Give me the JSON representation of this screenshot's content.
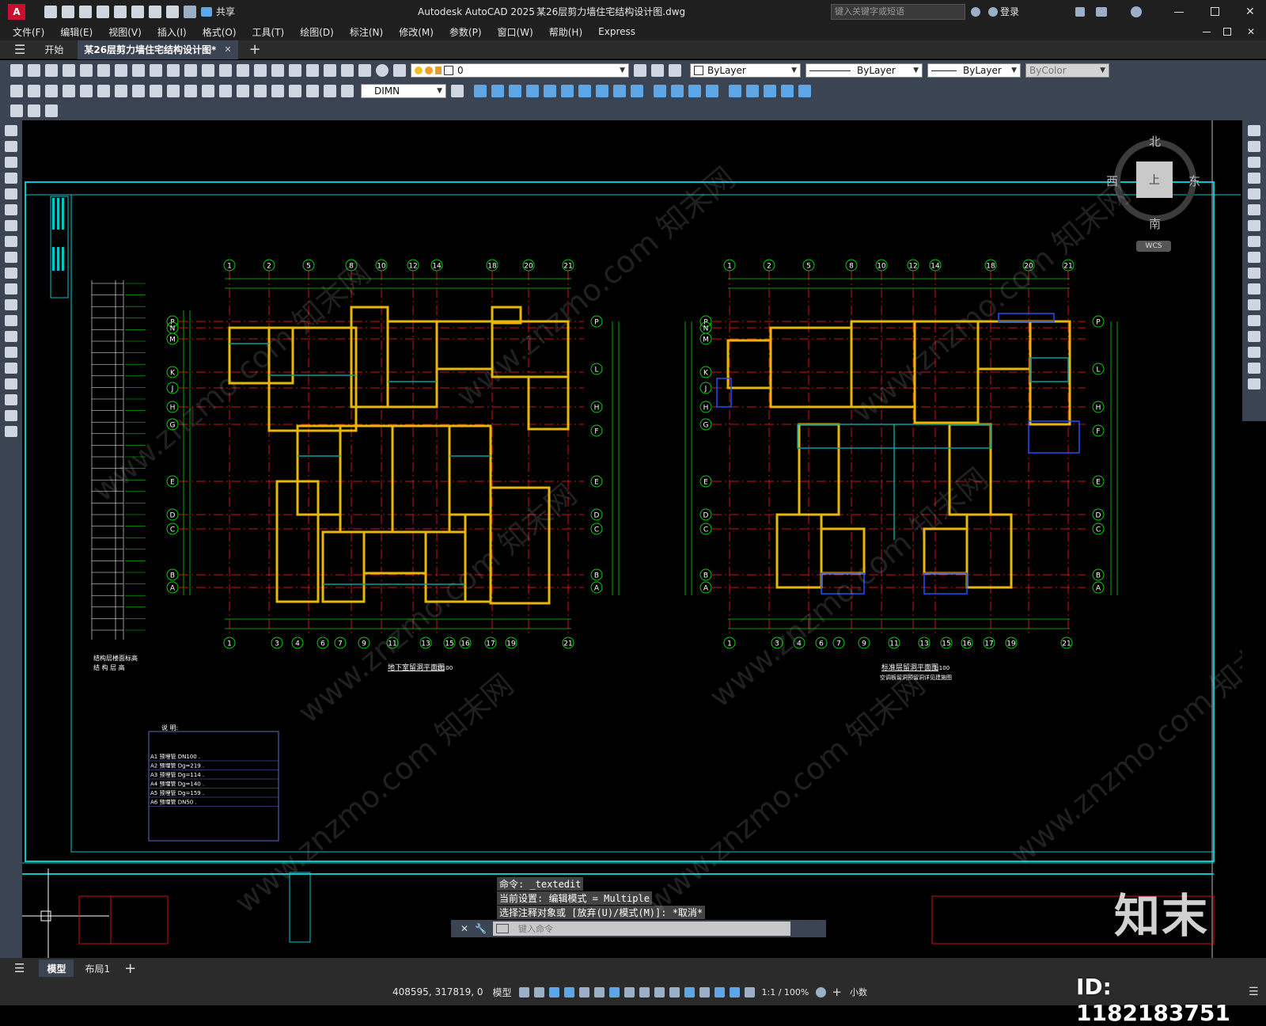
{
  "titlebar": {
    "app_badge": "A",
    "share_label": "共享",
    "app_title": "Autodesk AutoCAD 2025",
    "file_title": "某26层剪力墙住宅结构设计图.dwg",
    "search_placeholder": "键入关键字或短语",
    "login_label": "登录"
  },
  "menu": [
    "文件(F)",
    "编辑(E)",
    "视图(V)",
    "插入(I)",
    "格式(O)",
    "工具(T)",
    "绘图(D)",
    "标注(N)",
    "修改(M)",
    "参数(P)",
    "窗口(W)",
    "帮助(H)",
    "Express"
  ],
  "tabs": {
    "start": "开始",
    "document": "某26层剪力墙住宅结构设计图*"
  },
  "toolbar": {
    "layer_value": "0",
    "color_value": "ByLayer",
    "linetype_value": "ByLayer",
    "lineweight_value": "ByLayer",
    "plotstyle_value": "ByColor",
    "dimstyle_value": "DIMN"
  },
  "viewcube": {
    "north": "北",
    "south": "南",
    "east": "东",
    "west": "西",
    "top": "上",
    "wcs": "WCS"
  },
  "drawing": {
    "plan_left_title": "地下室留洞平面图",
    "plan_right_title": "标准层留洞平面图",
    "plan_right_subtitle": "空调板留洞预留洞详见建施图",
    "scale": "1:100",
    "notes_title": "说 明:",
    "notes": [
      "A1 预埋管 DN100 .",
      "A2 预埋管 Dg=219 .",
      "A3 预埋管 Dg=114 .",
      "A4 预埋管 Dg=140 .",
      "A5 预埋管 Dg=159 .",
      "A6 预埋管 DN50 ."
    ],
    "axis_top": [
      "1",
      "2",
      "5",
      "8",
      "10",
      "12",
      "14",
      "18",
      "20",
      "21"
    ],
    "axis_bottom": [
      "1",
      "3",
      "4",
      "6",
      "7",
      "9",
      "11",
      "13",
      "15",
      "16",
      "17",
      "19",
      "21"
    ],
    "axis_side": [
      "P",
      "N",
      "M",
      "K",
      "J",
      "H",
      "G",
      "E",
      "D",
      "C",
      "B",
      "A"
    ],
    "axis_right_side": [
      "P",
      "L",
      "H",
      "F",
      "E",
      "D",
      "C",
      "B",
      "A"
    ]
  },
  "command": {
    "history": [
      "命令: _textedit",
      "当前设置: 编辑模式 = Multiple",
      "选择注释对象或 [放弃(U)/模式(M)]: *取消*"
    ],
    "placeholder": "键入命令"
  },
  "layout_tabs": [
    "模型",
    "布局1"
  ],
  "status": {
    "coords": "408595, 317819, 0",
    "model": "模型",
    "annotation_scale": "1:1 / 100%",
    "units": "小数"
  },
  "overlay": {
    "brand": "知末",
    "id_label": "ID: 1182183751",
    "watermark": "www.znzmo.com  知末网"
  },
  "colors": {
    "background": "#000000",
    "cyan": "#00c8c8",
    "wall_yellow": "#e6b800",
    "axis_red": "#d01010",
    "dim_green": "#00d000",
    "toolbar_bg": "#3b4453"
  }
}
